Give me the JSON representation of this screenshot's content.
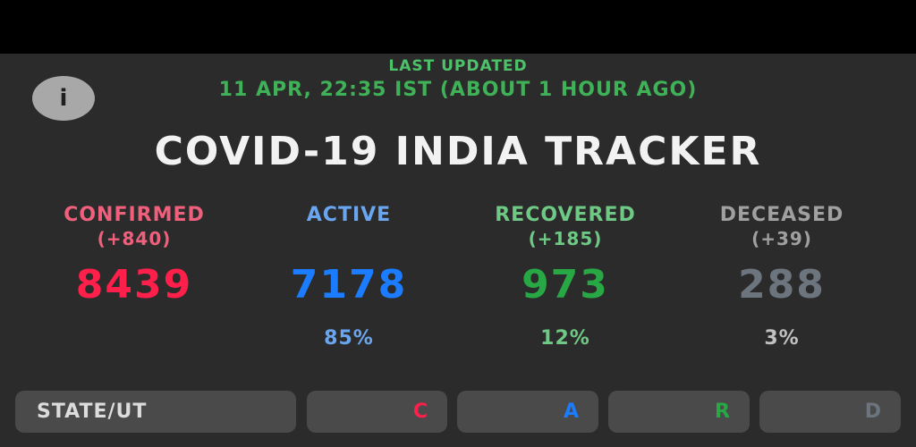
{
  "header": {
    "last_updated_label": "LAST UPDATED",
    "last_updated_time": "11 APR, 22:35 IST (ABOUT 1 HOUR AGO)",
    "info_icon": "i",
    "title": "COVID-19 INDIA TRACKER"
  },
  "stats": {
    "confirmed": {
      "label": "CONFIRMED",
      "delta": "(+840)",
      "value": "8439",
      "pct": "",
      "color": "#ff1f4b",
      "label_color": "#f0607d",
      "delta_color": "#f0607d"
    },
    "active": {
      "label": "ACTIVE",
      "delta": "",
      "value": "7178",
      "pct": "85%",
      "color": "#1b7cff",
      "label_color": "#6aa6f0",
      "delta_color": "#6aa6f0"
    },
    "recovered": {
      "label": "RECOVERED",
      "delta": "(+185)",
      "value": "973",
      "pct": "12%",
      "color": "#28a745",
      "label_color": "#6ec985",
      "delta_color": "#6ec985"
    },
    "deceased": {
      "label": "DECEASED",
      "delta": "(+39)",
      "value": "288",
      "pct": "3%",
      "color": "#6c757d",
      "label_color": "#a0a0a0",
      "delta_color": "#a0a0a0"
    }
  },
  "table_header": {
    "state_label": "STATE/UT",
    "confirmed_short": "C",
    "active_short": "A",
    "recovered_short": "R",
    "deceased_short": "D"
  }
}
